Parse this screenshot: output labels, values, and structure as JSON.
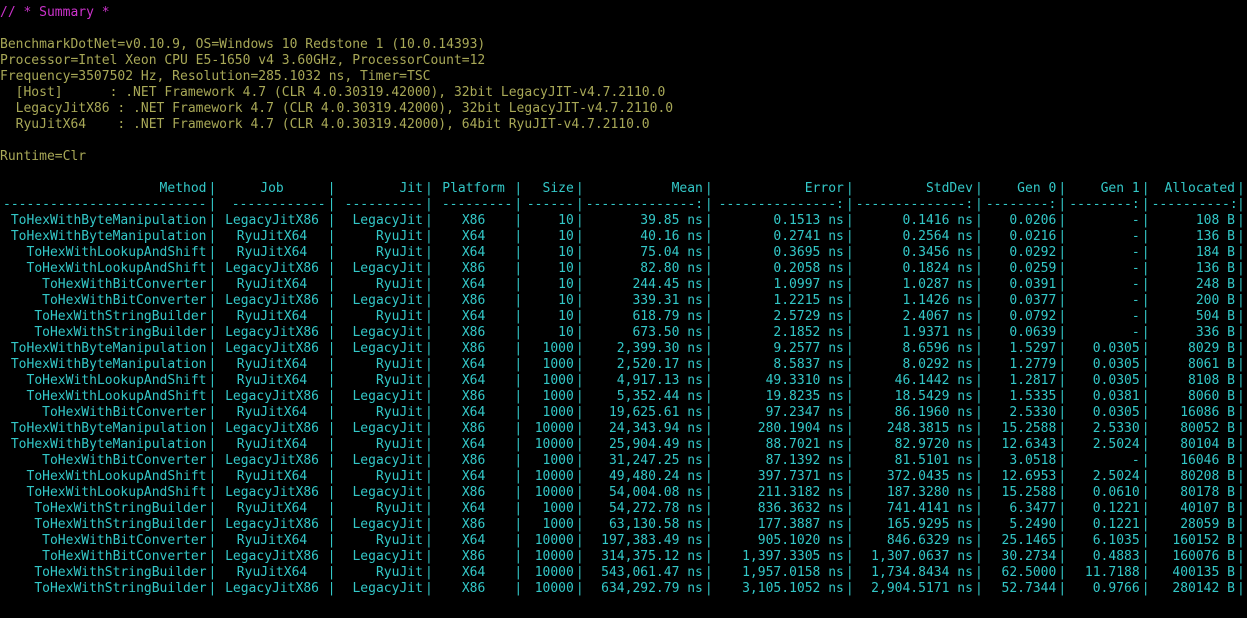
{
  "colors": {
    "background": "#000000",
    "header": "#cc33cc",
    "env": "#a8a857",
    "table": "#33c8c8"
  },
  "header": "// * Summary *",
  "env": {
    "lines": [
      "BenchmarkDotNet=v0.10.9, OS=Windows 10 Redstone 1 (10.0.14393)",
      "Processor=Intel Xeon CPU E5-1650 v4 3.60GHz, ProcessorCount=12",
      "Frequency=3507502 Hz, Resolution=285.1032 ns, Timer=TSC",
      "  [Host]      : .NET Framework 4.7 (CLR 4.0.30319.42000), 32bit LegacyJIT-v4.7.2110.0",
      "  LegacyJitX86 : .NET Framework 4.7 (CLR 4.0.30319.42000), 32bit LegacyJIT-v4.7.2110.0",
      "  RyuJitX64    : .NET Framework 4.7 (CLR 4.0.30319.42000), 64bit RyuJIT-v4.7.2110.0"
    ],
    "runtime": "Runtime=Clr"
  },
  "table": {
    "columns": [
      "Method",
      "Job",
      "Jit",
      "Platform",
      "Size",
      "Mean",
      "Error",
      "StdDev",
      "Gen 0",
      "Gen 1",
      "Allocated"
    ],
    "dividers": [
      "--------------------------",
      "------------",
      "----------",
      "---------",
      "------",
      "--------------:",
      "---------------:",
      "--------------:",
      "--------:",
      "--------:",
      "----------:"
    ],
    "rows": [
      [
        "ToHexWithByteManipulation",
        "LegacyJitX86",
        "LegacyJit",
        "X86",
        "10",
        "39.85 ns",
        "0.1513 ns",
        "0.1416 ns",
        "0.0206",
        "-",
        "108 B"
      ],
      [
        "ToHexWithByteManipulation",
        "RyuJitX64",
        "RyuJit",
        "X64",
        "10",
        "40.16 ns",
        "0.2741 ns",
        "0.2564 ns",
        "0.0216",
        "-",
        "136 B"
      ],
      [
        "ToHexWithLookupAndShift",
        "RyuJitX64",
        "RyuJit",
        "X64",
        "10",
        "75.04 ns",
        "0.3695 ns",
        "0.3456 ns",
        "0.0292",
        "-",
        "184 B"
      ],
      [
        "ToHexWithLookupAndShift",
        "LegacyJitX86",
        "LegacyJit",
        "X86",
        "10",
        "82.80 ns",
        "0.2058 ns",
        "0.1824 ns",
        "0.0259",
        "-",
        "136 B"
      ],
      [
        "ToHexWithBitConverter",
        "RyuJitX64",
        "RyuJit",
        "X64",
        "10",
        "244.45 ns",
        "1.0997 ns",
        "1.0287 ns",
        "0.0391",
        "-",
        "248 B"
      ],
      [
        "ToHexWithBitConverter",
        "LegacyJitX86",
        "LegacyJit",
        "X86",
        "10",
        "339.31 ns",
        "1.2215 ns",
        "1.1426 ns",
        "0.0377",
        "-",
        "200 B"
      ],
      [
        "ToHexWithStringBuilder",
        "RyuJitX64",
        "RyuJit",
        "X64",
        "10",
        "618.79 ns",
        "2.5729 ns",
        "2.4067 ns",
        "0.0792",
        "-",
        "504 B"
      ],
      [
        "ToHexWithStringBuilder",
        "LegacyJitX86",
        "LegacyJit",
        "X86",
        "10",
        "673.50 ns",
        "2.1852 ns",
        "1.9371 ns",
        "0.0639",
        "-",
        "336 B"
      ],
      [
        "ToHexWithByteManipulation",
        "LegacyJitX86",
        "LegacyJit",
        "X86",
        "1000",
        "2,399.30 ns",
        "9.2577 ns",
        "8.6596 ns",
        "1.5297",
        "0.0305",
        "8029 B"
      ],
      [
        "ToHexWithByteManipulation",
        "RyuJitX64",
        "RyuJit",
        "X64",
        "1000",
        "2,520.17 ns",
        "8.5837 ns",
        "8.0292 ns",
        "1.2779",
        "0.0305",
        "8061 B"
      ],
      [
        "ToHexWithLookupAndShift",
        "RyuJitX64",
        "RyuJit",
        "X64",
        "1000",
        "4,917.13 ns",
        "49.3310 ns",
        "46.1442 ns",
        "1.2817",
        "0.0305",
        "8108 B"
      ],
      [
        "ToHexWithLookupAndShift",
        "LegacyJitX86",
        "LegacyJit",
        "X86",
        "1000",
        "5,352.44 ns",
        "19.8235 ns",
        "18.5429 ns",
        "1.5335",
        "0.0381",
        "8060 B"
      ],
      [
        "ToHexWithBitConverter",
        "RyuJitX64",
        "RyuJit",
        "X64",
        "1000",
        "19,625.61 ns",
        "97.2347 ns",
        "86.1960 ns",
        "2.5330",
        "0.0305",
        "16086 B"
      ],
      [
        "ToHexWithByteManipulation",
        "LegacyJitX86",
        "LegacyJit",
        "X86",
        "10000",
        "24,343.94 ns",
        "280.1904 ns",
        "248.3815 ns",
        "15.2588",
        "2.5330",
        "80052 B"
      ],
      [
        "ToHexWithByteManipulation",
        "RyuJitX64",
        "RyuJit",
        "X64",
        "10000",
        "25,904.49 ns",
        "88.7021 ns",
        "82.9720 ns",
        "12.6343",
        "2.5024",
        "80104 B"
      ],
      [
        "ToHexWithBitConverter",
        "LegacyJitX86",
        "LegacyJit",
        "X86",
        "1000",
        "31,247.25 ns",
        "87.1392 ns",
        "81.5101 ns",
        "3.0518",
        "-",
        "16046 B"
      ],
      [
        "ToHexWithLookupAndShift",
        "RyuJitX64",
        "RyuJit",
        "X64",
        "10000",
        "49,480.24 ns",
        "397.7371 ns",
        "372.0435 ns",
        "12.6953",
        "2.5024",
        "80208 B"
      ],
      [
        "ToHexWithLookupAndShift",
        "LegacyJitX86",
        "LegacyJit",
        "X86",
        "10000",
        "54,004.08 ns",
        "211.3182 ns",
        "187.3280 ns",
        "15.2588",
        "0.0610",
        "80178 B"
      ],
      [
        "ToHexWithStringBuilder",
        "RyuJitX64",
        "RyuJit",
        "X64",
        "1000",
        "54,272.78 ns",
        "836.3632 ns",
        "741.4141 ns",
        "6.3477",
        "0.1221",
        "40107 B"
      ],
      [
        "ToHexWithStringBuilder",
        "LegacyJitX86",
        "LegacyJit",
        "X86",
        "1000",
        "63,130.58 ns",
        "177.3887 ns",
        "165.9295 ns",
        "5.2490",
        "0.1221",
        "28059 B"
      ],
      [
        "ToHexWithBitConverter",
        "RyuJitX64",
        "RyuJit",
        "X64",
        "10000",
        "197,383.49 ns",
        "905.1020 ns",
        "846.6329 ns",
        "25.1465",
        "6.1035",
        "160152 B"
      ],
      [
        "ToHexWithBitConverter",
        "LegacyJitX86",
        "LegacyJit",
        "X86",
        "10000",
        "314,375.12 ns",
        "1,397.3305 ns",
        "1,307.0637 ns",
        "30.2734",
        "0.4883",
        "160076 B"
      ],
      [
        "ToHexWithStringBuilder",
        "RyuJitX64",
        "RyuJit",
        "X64",
        "10000",
        "543,061.47 ns",
        "1,957.0158 ns",
        "1,734.8434 ns",
        "62.5000",
        "11.7188",
        "400135 B"
      ],
      [
        "ToHexWithStringBuilder",
        "LegacyJitX86",
        "LegacyJit",
        "X86",
        "10000",
        "634,292.79 ns",
        "3,105.1052 ns",
        "2,904.5171 ns",
        "52.7344",
        "0.9766",
        "280142 B"
      ]
    ]
  }
}
